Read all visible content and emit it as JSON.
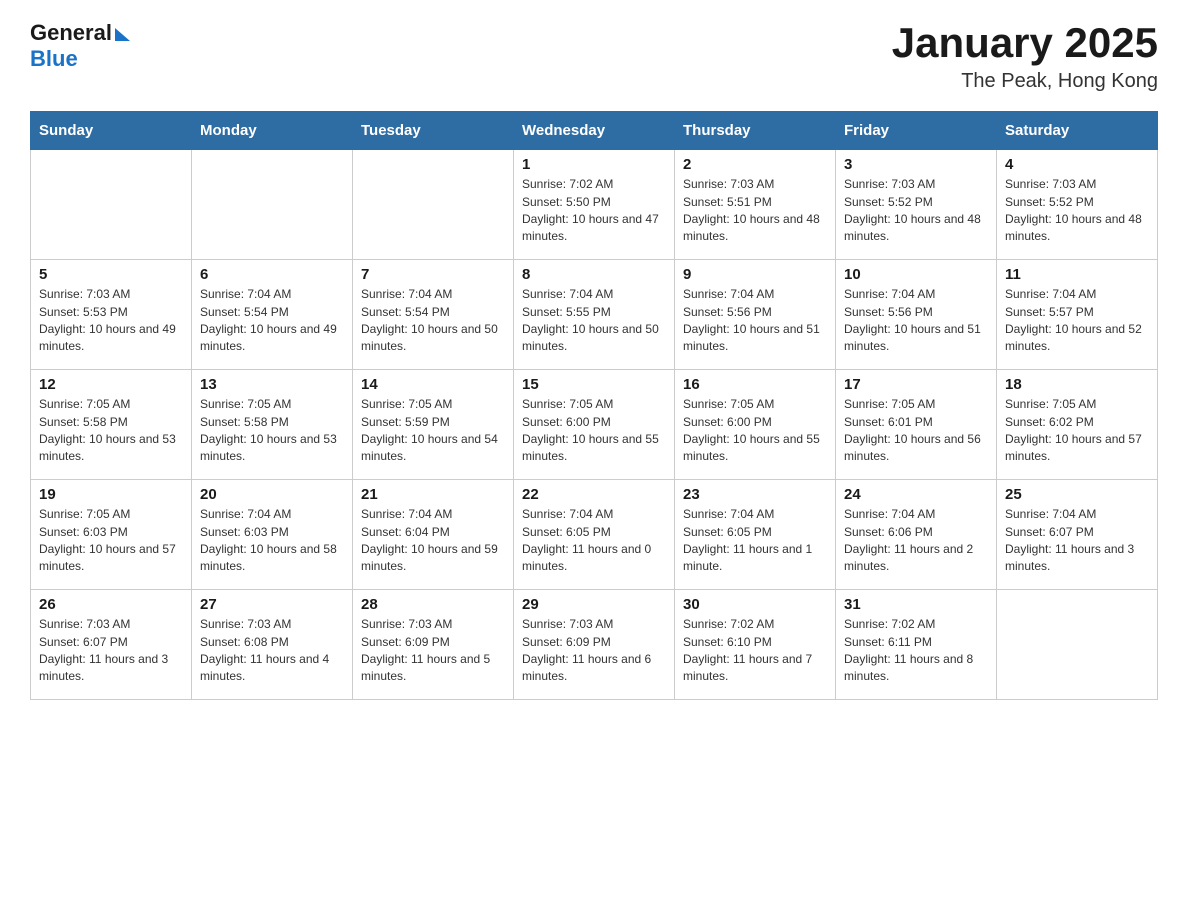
{
  "header": {
    "logo_general": "General",
    "logo_blue": "Blue",
    "title": "January 2025",
    "subtitle": "The Peak, Hong Kong"
  },
  "days_of_week": [
    "Sunday",
    "Monday",
    "Tuesday",
    "Wednesday",
    "Thursday",
    "Friday",
    "Saturday"
  ],
  "weeks": [
    [
      {
        "day": "",
        "sunrise": "",
        "sunset": "",
        "daylight": ""
      },
      {
        "day": "",
        "sunrise": "",
        "sunset": "",
        "daylight": ""
      },
      {
        "day": "",
        "sunrise": "",
        "sunset": "",
        "daylight": ""
      },
      {
        "day": "1",
        "sunrise": "Sunrise: 7:02 AM",
        "sunset": "Sunset: 5:50 PM",
        "daylight": "Daylight: 10 hours and 47 minutes."
      },
      {
        "day": "2",
        "sunrise": "Sunrise: 7:03 AM",
        "sunset": "Sunset: 5:51 PM",
        "daylight": "Daylight: 10 hours and 48 minutes."
      },
      {
        "day": "3",
        "sunrise": "Sunrise: 7:03 AM",
        "sunset": "Sunset: 5:52 PM",
        "daylight": "Daylight: 10 hours and 48 minutes."
      },
      {
        "day": "4",
        "sunrise": "Sunrise: 7:03 AM",
        "sunset": "Sunset: 5:52 PM",
        "daylight": "Daylight: 10 hours and 48 minutes."
      }
    ],
    [
      {
        "day": "5",
        "sunrise": "Sunrise: 7:03 AM",
        "sunset": "Sunset: 5:53 PM",
        "daylight": "Daylight: 10 hours and 49 minutes."
      },
      {
        "day": "6",
        "sunrise": "Sunrise: 7:04 AM",
        "sunset": "Sunset: 5:54 PM",
        "daylight": "Daylight: 10 hours and 49 minutes."
      },
      {
        "day": "7",
        "sunrise": "Sunrise: 7:04 AM",
        "sunset": "Sunset: 5:54 PM",
        "daylight": "Daylight: 10 hours and 50 minutes."
      },
      {
        "day": "8",
        "sunrise": "Sunrise: 7:04 AM",
        "sunset": "Sunset: 5:55 PM",
        "daylight": "Daylight: 10 hours and 50 minutes."
      },
      {
        "day": "9",
        "sunrise": "Sunrise: 7:04 AM",
        "sunset": "Sunset: 5:56 PM",
        "daylight": "Daylight: 10 hours and 51 minutes."
      },
      {
        "day": "10",
        "sunrise": "Sunrise: 7:04 AM",
        "sunset": "Sunset: 5:56 PM",
        "daylight": "Daylight: 10 hours and 51 minutes."
      },
      {
        "day": "11",
        "sunrise": "Sunrise: 7:04 AM",
        "sunset": "Sunset: 5:57 PM",
        "daylight": "Daylight: 10 hours and 52 minutes."
      }
    ],
    [
      {
        "day": "12",
        "sunrise": "Sunrise: 7:05 AM",
        "sunset": "Sunset: 5:58 PM",
        "daylight": "Daylight: 10 hours and 53 minutes."
      },
      {
        "day": "13",
        "sunrise": "Sunrise: 7:05 AM",
        "sunset": "Sunset: 5:58 PM",
        "daylight": "Daylight: 10 hours and 53 minutes."
      },
      {
        "day": "14",
        "sunrise": "Sunrise: 7:05 AM",
        "sunset": "Sunset: 5:59 PM",
        "daylight": "Daylight: 10 hours and 54 minutes."
      },
      {
        "day": "15",
        "sunrise": "Sunrise: 7:05 AM",
        "sunset": "Sunset: 6:00 PM",
        "daylight": "Daylight: 10 hours and 55 minutes."
      },
      {
        "day": "16",
        "sunrise": "Sunrise: 7:05 AM",
        "sunset": "Sunset: 6:00 PM",
        "daylight": "Daylight: 10 hours and 55 minutes."
      },
      {
        "day": "17",
        "sunrise": "Sunrise: 7:05 AM",
        "sunset": "Sunset: 6:01 PM",
        "daylight": "Daylight: 10 hours and 56 minutes."
      },
      {
        "day": "18",
        "sunrise": "Sunrise: 7:05 AM",
        "sunset": "Sunset: 6:02 PM",
        "daylight": "Daylight: 10 hours and 57 minutes."
      }
    ],
    [
      {
        "day": "19",
        "sunrise": "Sunrise: 7:05 AM",
        "sunset": "Sunset: 6:03 PM",
        "daylight": "Daylight: 10 hours and 57 minutes."
      },
      {
        "day": "20",
        "sunrise": "Sunrise: 7:04 AM",
        "sunset": "Sunset: 6:03 PM",
        "daylight": "Daylight: 10 hours and 58 minutes."
      },
      {
        "day": "21",
        "sunrise": "Sunrise: 7:04 AM",
        "sunset": "Sunset: 6:04 PM",
        "daylight": "Daylight: 10 hours and 59 minutes."
      },
      {
        "day": "22",
        "sunrise": "Sunrise: 7:04 AM",
        "sunset": "Sunset: 6:05 PM",
        "daylight": "Daylight: 11 hours and 0 minutes."
      },
      {
        "day": "23",
        "sunrise": "Sunrise: 7:04 AM",
        "sunset": "Sunset: 6:05 PM",
        "daylight": "Daylight: 11 hours and 1 minute."
      },
      {
        "day": "24",
        "sunrise": "Sunrise: 7:04 AM",
        "sunset": "Sunset: 6:06 PM",
        "daylight": "Daylight: 11 hours and 2 minutes."
      },
      {
        "day": "25",
        "sunrise": "Sunrise: 7:04 AM",
        "sunset": "Sunset: 6:07 PM",
        "daylight": "Daylight: 11 hours and 3 minutes."
      }
    ],
    [
      {
        "day": "26",
        "sunrise": "Sunrise: 7:03 AM",
        "sunset": "Sunset: 6:07 PM",
        "daylight": "Daylight: 11 hours and 3 minutes."
      },
      {
        "day": "27",
        "sunrise": "Sunrise: 7:03 AM",
        "sunset": "Sunset: 6:08 PM",
        "daylight": "Daylight: 11 hours and 4 minutes."
      },
      {
        "day": "28",
        "sunrise": "Sunrise: 7:03 AM",
        "sunset": "Sunset: 6:09 PM",
        "daylight": "Daylight: 11 hours and 5 minutes."
      },
      {
        "day": "29",
        "sunrise": "Sunrise: 7:03 AM",
        "sunset": "Sunset: 6:09 PM",
        "daylight": "Daylight: 11 hours and 6 minutes."
      },
      {
        "day": "30",
        "sunrise": "Sunrise: 7:02 AM",
        "sunset": "Sunset: 6:10 PM",
        "daylight": "Daylight: 11 hours and 7 minutes."
      },
      {
        "day": "31",
        "sunrise": "Sunrise: 7:02 AM",
        "sunset": "Sunset: 6:11 PM",
        "daylight": "Daylight: 11 hours and 8 minutes."
      },
      {
        "day": "",
        "sunrise": "",
        "sunset": "",
        "daylight": ""
      }
    ]
  ]
}
